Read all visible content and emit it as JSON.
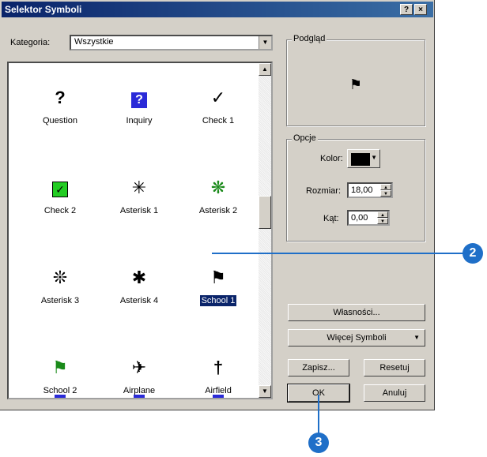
{
  "title": "Selektor Symboli",
  "titlebar_buttons": {
    "help": "?",
    "close": "×"
  },
  "category": {
    "label": "Kategoria:",
    "value": "Wszystkie"
  },
  "symbols": [
    {
      "name": "Question",
      "glyph": "?",
      "color": "#000000"
    },
    {
      "name": "Inquiry",
      "glyph": "?",
      "color": "#ffffff"
    },
    {
      "name": "Check 1",
      "glyph": "✓",
      "color": "#000000"
    },
    {
      "name": "Check 2",
      "glyph": "✓",
      "color": "#000000"
    },
    {
      "name": "Asterisk 1",
      "glyph": "✳",
      "color": "#000000"
    },
    {
      "name": "Asterisk 2",
      "glyph": "❋",
      "color": "#1a8a1a"
    },
    {
      "name": "Asterisk 3",
      "glyph": "❊",
      "color": "#000000"
    },
    {
      "name": "Asterisk 4",
      "glyph": "✱",
      "color": "#000000"
    },
    {
      "name": "School 1",
      "glyph": "⚑",
      "color": "#000000",
      "selected": true
    },
    {
      "name": "School 2",
      "glyph": "⚑",
      "color": "#1a8a1a"
    },
    {
      "name": "Airplane",
      "glyph": "✈",
      "color": "#000000"
    },
    {
      "name": "Airfield",
      "glyph": "†",
      "color": "#000000"
    }
  ],
  "preview": {
    "title": "Podgląd",
    "glyph": "⚑"
  },
  "options": {
    "title": "Opcje",
    "color_label": "Kolor:",
    "color_value": "#000000",
    "size_label": "Rozmiar:",
    "size_value": "18,00",
    "angle_label": "Kąt:",
    "angle_value": "0,00"
  },
  "buttons": {
    "properties": "Własności...",
    "more_symbols": "Więcej Symboli",
    "save": "Zapisz...",
    "reset": "Resetuj",
    "ok": "OK",
    "cancel": "Anuluj"
  },
  "callouts": {
    "c2": "2",
    "c3": "3"
  },
  "colors": {
    "callout": "#1f6fc8",
    "titlebar": "#0a246a",
    "selection": "#0a246a"
  }
}
